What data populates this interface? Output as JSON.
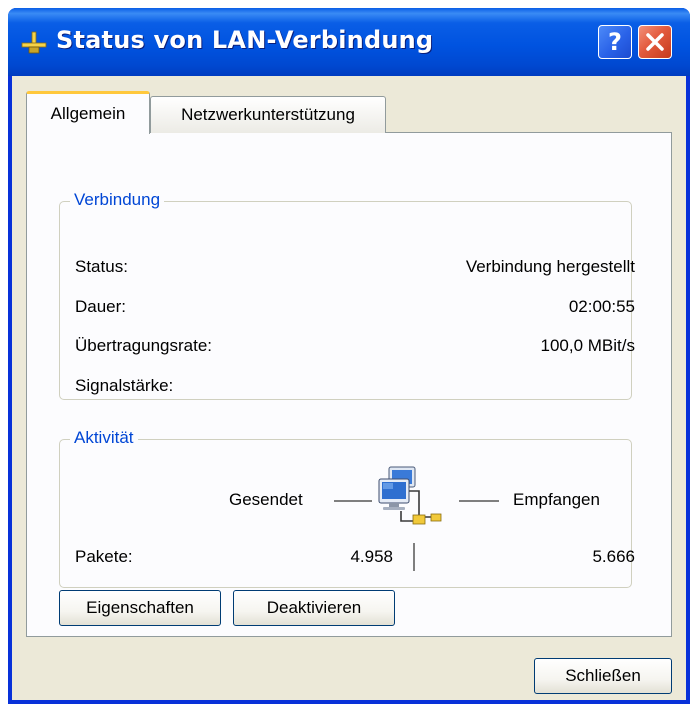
{
  "window": {
    "title": "Status von LAN-Verbindung",
    "help_glyph": "?"
  },
  "tabs": [
    {
      "label": "Allgemein",
      "active": true
    },
    {
      "label": "Netzwerkunterstützung",
      "active": false
    }
  ],
  "connection": {
    "group_title": "Verbindung",
    "rows": [
      {
        "label": "Status:",
        "value": "Verbindung hergestellt"
      },
      {
        "label": "Dauer:",
        "value": "02:00:55"
      },
      {
        "label": "Übertragungsrate:",
        "value": "100,0 MBit/s"
      },
      {
        "label": "Signalstärke:",
        "value": ""
      }
    ]
  },
  "activity": {
    "group_title": "Aktivität",
    "sent_label": "Gesendet",
    "received_label": "Empfangen",
    "packets_label": "Pakete:",
    "packets_sent": "4.958",
    "packets_received": "5.666"
  },
  "buttons": {
    "properties": "Eigenschaften",
    "disable": "Deaktivieren",
    "close": "Schließen"
  },
  "icons": {
    "title": "network-connection-icon",
    "activity": "network-computers-icon",
    "help": "help-icon",
    "close": "close-icon"
  },
  "colors": {
    "titlebar": "#0054e3",
    "window_bg": "#ece9d8",
    "group_title": "#0046d5",
    "close_button": "#e35b3e",
    "tab_highlight": "#ffc83c"
  }
}
